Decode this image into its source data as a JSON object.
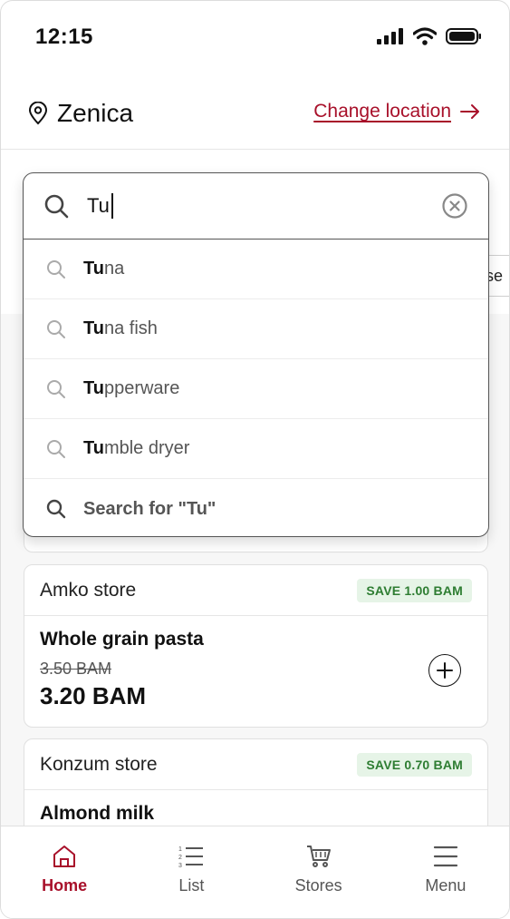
{
  "status_bar": {
    "time": "12:15"
  },
  "location": {
    "city": "Zenica",
    "change_label": "Change location"
  },
  "search": {
    "value": "Tu",
    "suggestions": [
      {
        "match": "Tu",
        "rest": "na"
      },
      {
        "match": "Tu",
        "rest": "na fish"
      },
      {
        "match": "Tu",
        "rest": "pperware"
      },
      {
        "match": "Tu",
        "rest": "mble dryer"
      }
    ],
    "search_all_label": "Search for \"Tu\""
  },
  "hidden_chip_text": "se",
  "cards": [
    {
      "store": "Amko store",
      "save_badge": "SAVE 1.00 BAM",
      "product": "Whole grain pasta",
      "old_price": "3.50 BAM",
      "new_price": "3.20 BAM"
    },
    {
      "store": "Konzum store",
      "save_badge": "SAVE 0.70 BAM",
      "product": "Almond milk"
    }
  ],
  "nav": {
    "home": "Home",
    "list": "List",
    "stores": "Stores",
    "menu": "Menu"
  },
  "colors": {
    "accent": "#a8102a",
    "save_green": "#2e7d32",
    "save_bg": "#e6f4e7"
  },
  "icons": [
    "signal-icon",
    "wifi-icon",
    "battery-icon",
    "location-pin-icon",
    "arrow-right-icon",
    "search-icon",
    "clear-icon",
    "plus-circle-icon",
    "home-icon",
    "list-icon",
    "cart-icon",
    "menu-icon"
  ]
}
